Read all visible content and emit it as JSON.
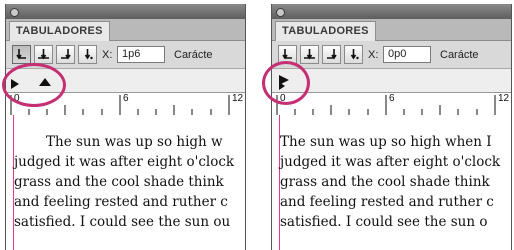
{
  "panels": [
    {
      "tab_title": "TABULADORES",
      "x_label": "X:",
      "x_value": "1p6",
      "char_label": "Carácte",
      "ruler_labels": [
        "0",
        "6",
        "12"
      ],
      "text_lines": [
        "The sun was up so high w",
        "judged it was after eight o'clock",
        "grass and the cool shade think",
        "and feeling rested and ruther c",
        "satisfied. I could see the sun ou"
      ]
    },
    {
      "tab_title": "TABULADORES",
      "x_label": "X:",
      "x_value": "0p0",
      "char_label": "Carácte",
      "ruler_labels": [
        "0",
        "6",
        "12"
      ],
      "text_lines": [
        "The sun was up so high when I",
        "judged it was after eight o'clock",
        "grass and the cool shade think",
        "and feeling rested and ruther c",
        "satisfied. I could see the sun o"
      ]
    }
  ],
  "toolbar_icons": [
    "left-justified-tab-icon",
    "center-justified-tab-icon",
    "right-justified-tab-icon",
    "align-to-decimal-tab-icon"
  ],
  "colors": {
    "highlight_circle": "#c52f73",
    "margin_line": "#e23a8c"
  }
}
